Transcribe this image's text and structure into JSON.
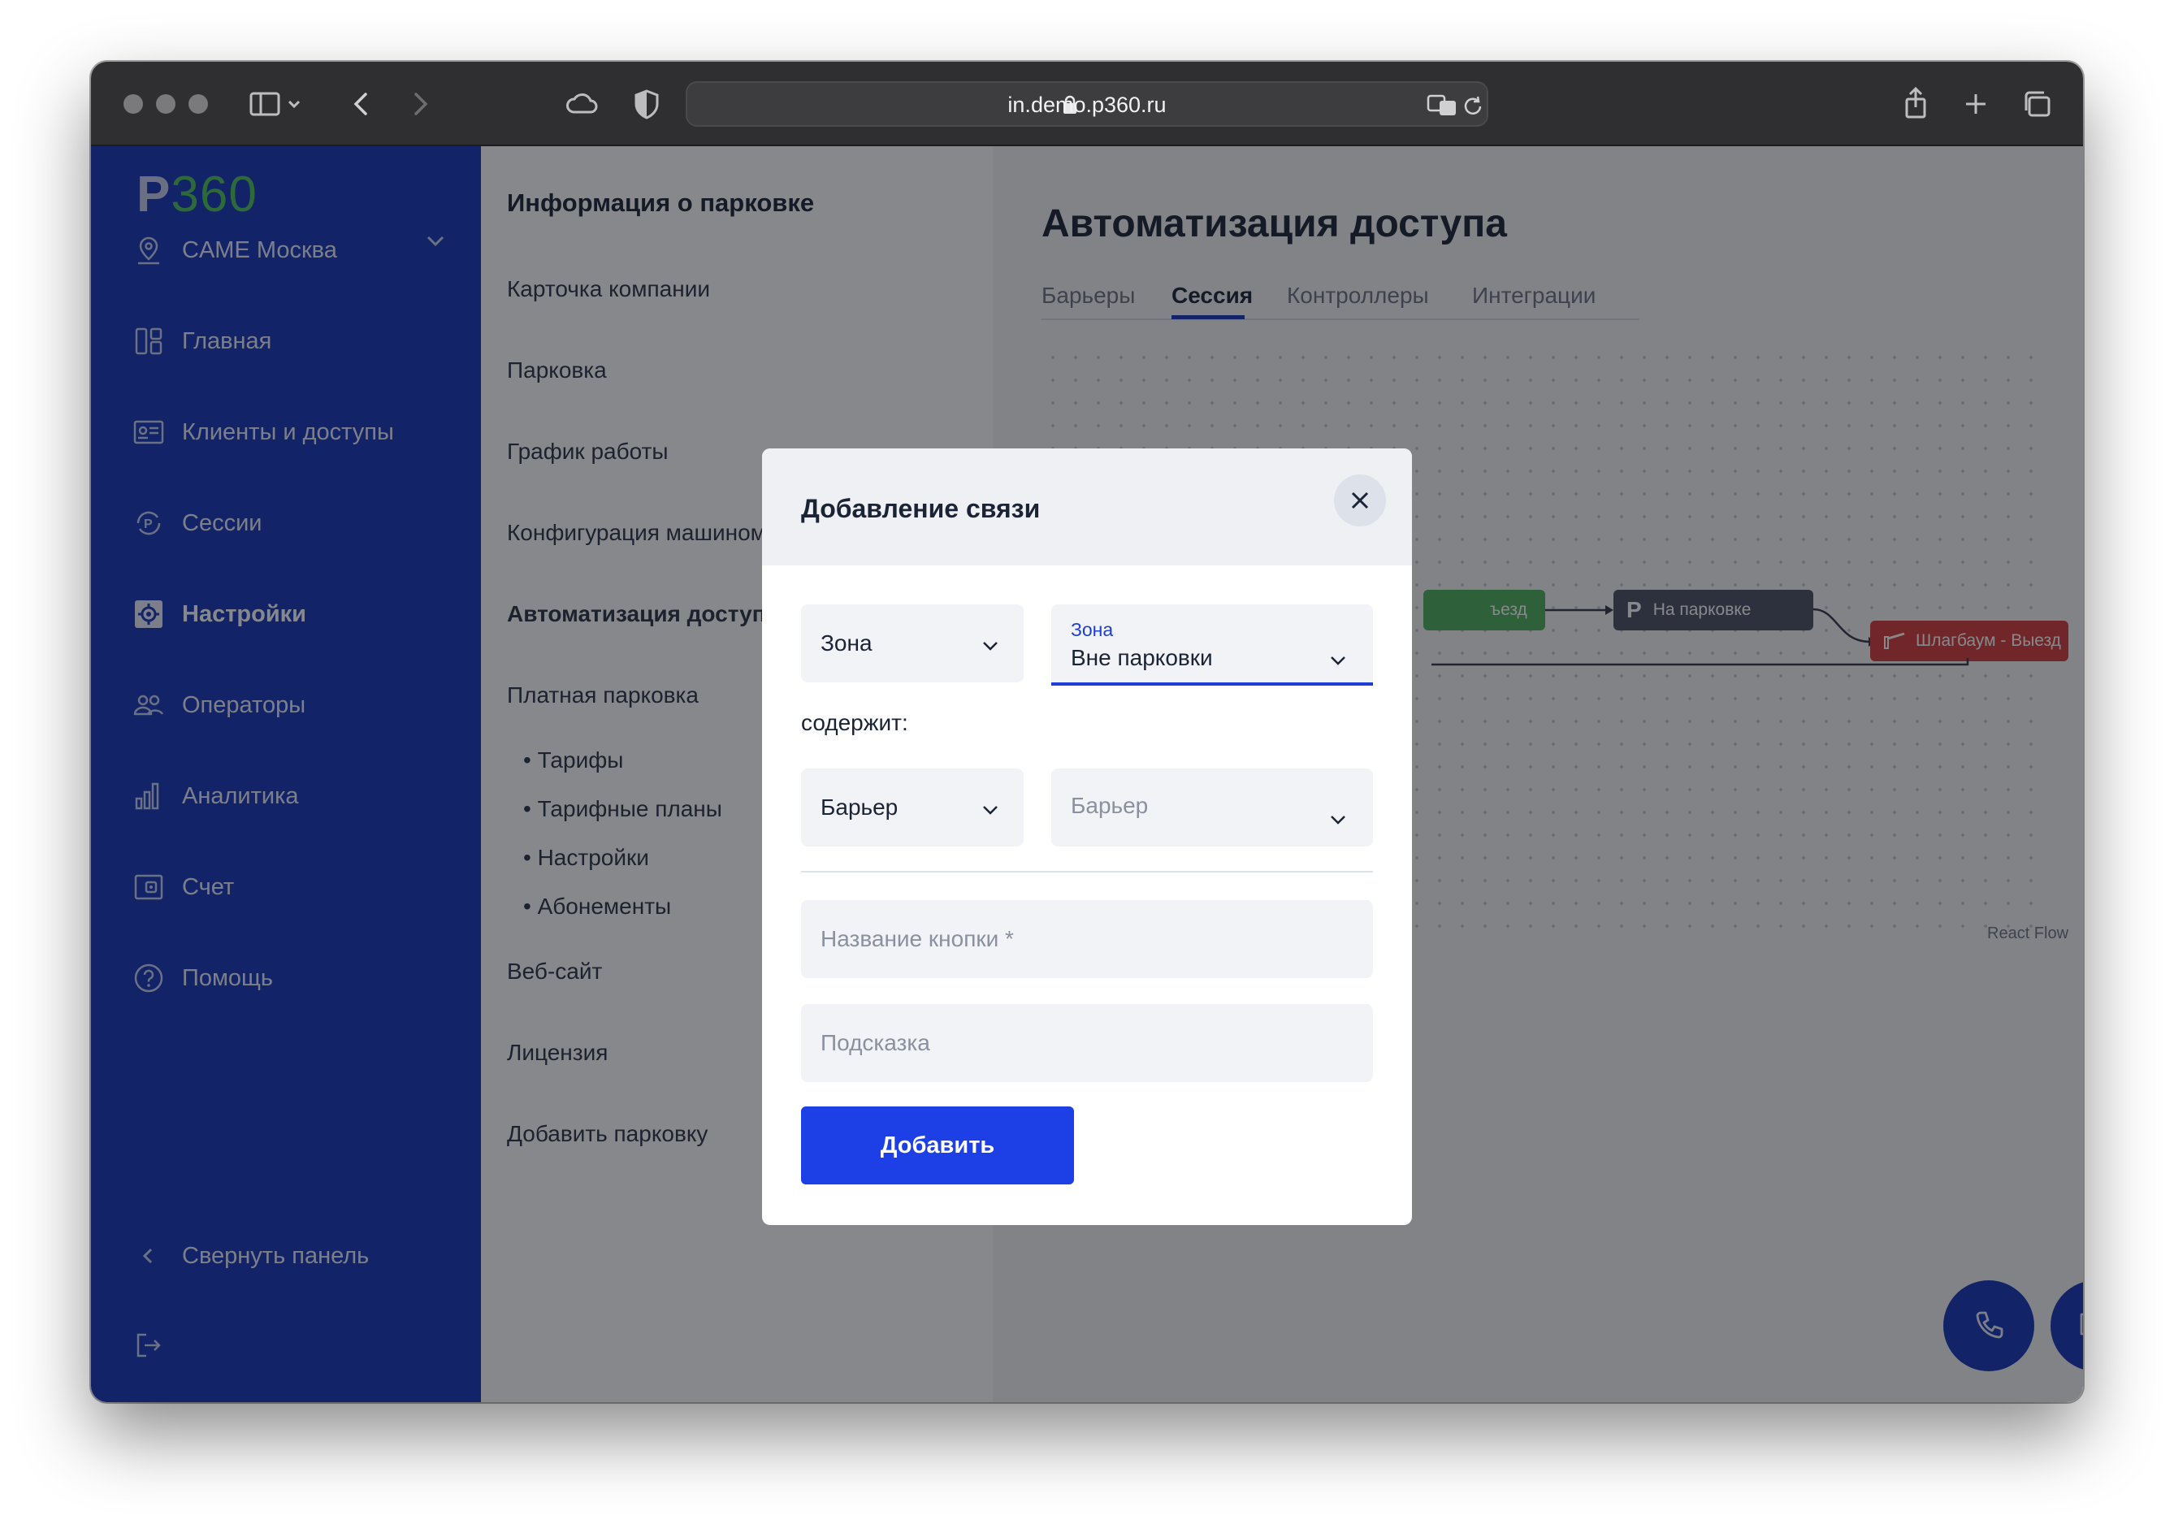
{
  "browser": {
    "url": "in.demo.p360.ru"
  },
  "app": {
    "logo_letter": "P",
    "logo_number": "360",
    "company": "CAME Москва",
    "nav": [
      {
        "label": "Главная",
        "icon": "dashboard-icon"
      },
      {
        "label": "Клиенты и доступы",
        "icon": "id-card-icon"
      },
      {
        "label": "Сессии",
        "icon": "parking-session-icon"
      },
      {
        "label": "Настройки",
        "icon": "settings-icon",
        "active": true
      },
      {
        "label": "Операторы",
        "icon": "users-icon"
      },
      {
        "label": "Аналитика",
        "icon": "bar-chart-icon"
      },
      {
        "label": "Счет",
        "icon": "wallet-icon"
      },
      {
        "label": "Помощь",
        "icon": "help-icon"
      }
    ],
    "collapse_label": "Свернуть панель"
  },
  "subnav": {
    "title": "Информация о парковке",
    "items": [
      "Карточка компании",
      "Парковка",
      "График работы",
      "Конфигурация машиноместа",
      "Автоматизация доступа",
      "Платная парковка",
      "Веб-сайт",
      "Лицензия",
      "Добавить парковку"
    ],
    "paid_subitems": [
      "• Тарифы",
      "• Тарифные планы",
      "• Настройки",
      "• Абонементы"
    ]
  },
  "main": {
    "title": "Автоматизация доступа",
    "tabs": [
      "Барьеры",
      "Сессия",
      "Контроллеры",
      "Интеграции"
    ],
    "active_tab": "Сессия",
    "flow": {
      "node_entry_partial": "ъезд",
      "node_parking": "На парковке",
      "node_barrier": "Шлагбаум - Выезд",
      "attribution": "React Flow"
    }
  },
  "modal": {
    "title": "Добавление связи",
    "type_select_1": "Зона",
    "zone_label": "Зона",
    "zone_value": "Вне парковки",
    "contains_label": "содержит:",
    "type_select_2": "Барьер",
    "barrier_placeholder": "Барьер",
    "button_name_placeholder": "Название кнопки *",
    "hint_placeholder": "Подсказка",
    "submit_label": "Добавить"
  },
  "colors": {
    "sidebar": "#1534b8",
    "primary_button": "#1d3fe6",
    "node_green": "#4cae5a",
    "node_dark": "#4a5163",
    "node_red": "#d33a3a"
  }
}
